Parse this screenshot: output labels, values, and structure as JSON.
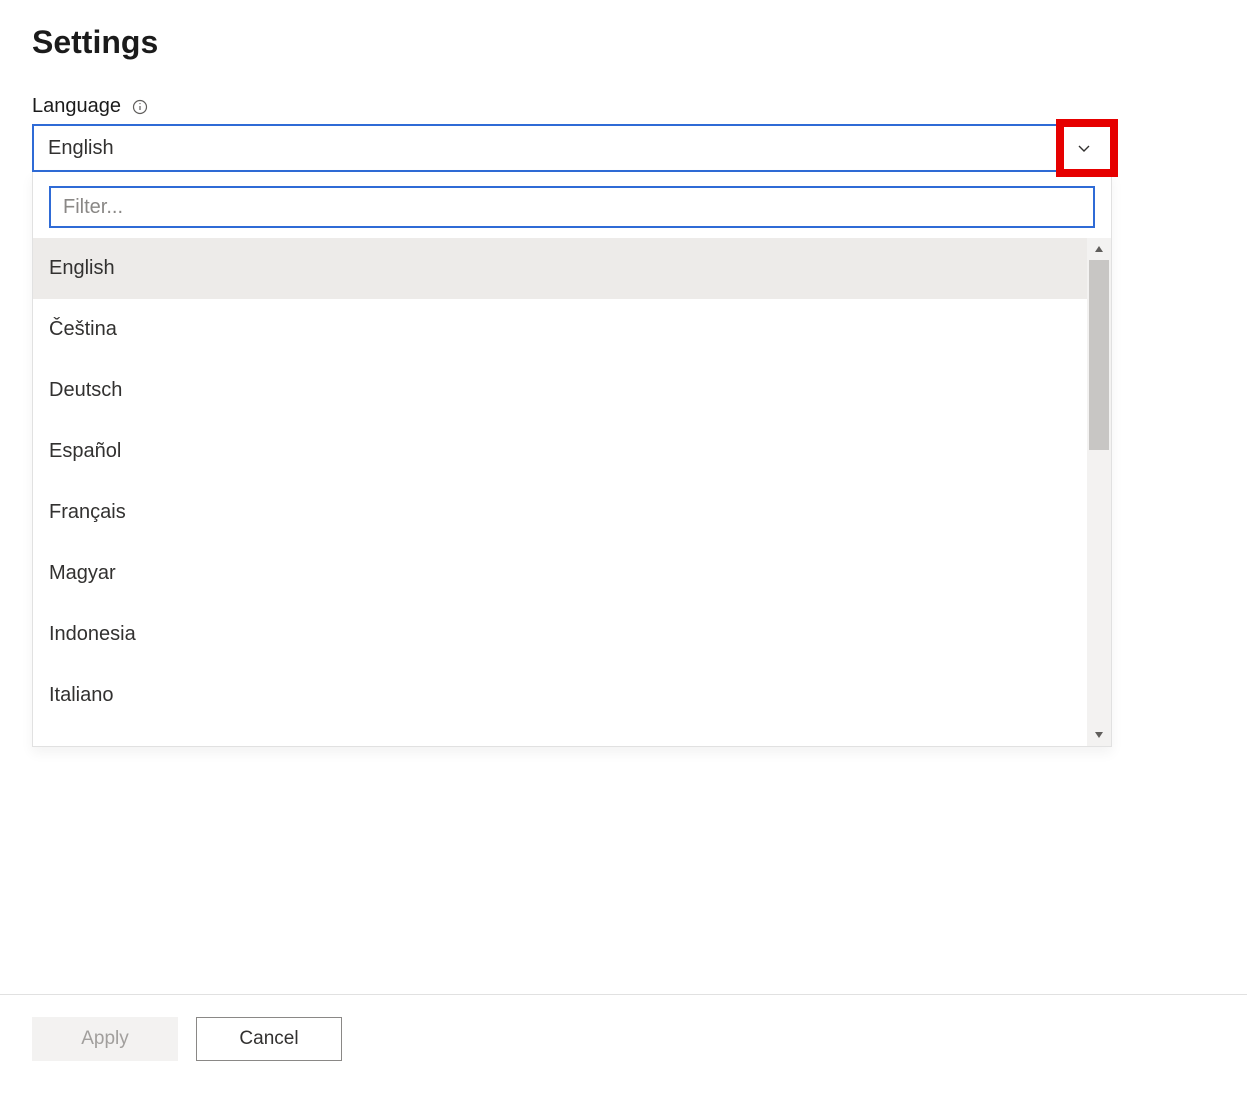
{
  "title": "Settings",
  "language": {
    "label": "Language",
    "selected": "English",
    "filter_placeholder": "Filter...",
    "options": [
      "English",
      "Čeština",
      "Deutsch",
      "Español",
      "Français",
      "Magyar",
      "Indonesia",
      "Italiano"
    ]
  },
  "buttons": {
    "apply": "Apply",
    "cancel": "Cancel"
  }
}
